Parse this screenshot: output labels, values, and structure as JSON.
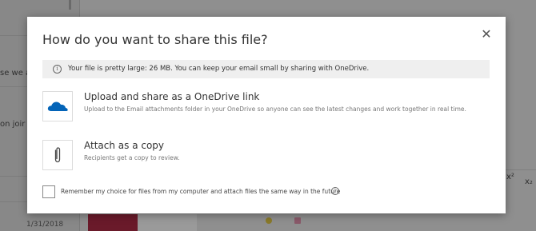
{
  "background": {
    "list_snippets": [
      "se we a",
      "on joir"
    ],
    "date": "1/31/2018",
    "toolbar_glyphs": [
      "x²",
      "x₂"
    ]
  },
  "dialog": {
    "title": "How do you want to share this file?",
    "close_label": "✕",
    "info": {
      "icon": "info-icon",
      "text": "Your file is pretty large: 26 MB. You can keep your email small by sharing with OneDrive."
    },
    "options": [
      {
        "icon": "onedrive-cloud-icon",
        "title": "Upload and share as a OneDrive link",
        "description": "Upload to the Email attachments folder in your OneDrive so anyone can see the latest changes and work together in real time."
      },
      {
        "icon": "paperclip-icon",
        "title": "Attach as a copy",
        "description": "Recipients get a copy to review."
      }
    ],
    "remember": {
      "checked": false,
      "label": "Remember my choice for files from my computer and attach files the same way in the future",
      "help_icon": "info-icon"
    }
  },
  "colors": {
    "onedrive_blue": "#0364b8",
    "overlay_gray": "#8c8c8c",
    "info_bar_bg": "#efefef",
    "send_button": "#6a1a2a"
  }
}
